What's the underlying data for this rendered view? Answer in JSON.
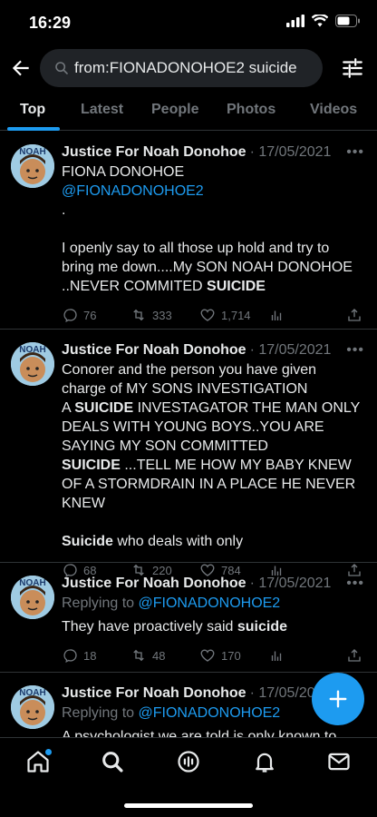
{
  "status": {
    "time": "16:29"
  },
  "search": {
    "query": "from:FIONADONOHOE2 suicide"
  },
  "tabs": [
    {
      "label": "Top"
    },
    {
      "label": "Latest"
    },
    {
      "label": "People"
    },
    {
      "label": "Photos"
    },
    {
      "label": "Videos"
    }
  ],
  "tweets": [
    {
      "author": "Justice For Noah Donohoe",
      "meta": "· 17/05/2021",
      "line1": "FIONA DONOHOE",
      "mention": "@FIONADONOHOE2",
      "dot": ".",
      "para1": "I openly say to all those up hold and try to bring me down....My SON NOAH DONOHOE ..NEVER COMMITED ",
      "para1_bold": "SUICIDE",
      "replies": "76",
      "retweets": "333",
      "likes": "1,714"
    },
    {
      "author": "Justice For Noah Donohoe",
      "meta": "· 17/05/2021",
      "line1": "Conorer and the person  you have given charge of MY SONS INVESTIGATION",
      "line2_pre": "A ",
      "line2_bold": "SUICIDE",
      "line2_post": " INVESTAGATOR THE MAN ONLY DEALS WITH YOUNG BOYS..YOU ARE SAYING MY SON COMMITTED",
      "line3_bold": "SUICIDE",
      "line3_post": " ...TELL ME HOW MY BABY KNEW OF A STORMDRAIN IN A PLACE HE NEVER KNEW",
      "line4_bold": "Suicide",
      "line4_post": " who deals with only",
      "replies": "68",
      "retweets": "220",
      "likes": "784"
    },
    {
      "author": "Justice For Noah Donohoe",
      "meta": "· 17/05/2021",
      "reply_label": "Replying to ",
      "reply_mention": "@FIONADONOHOE2",
      "text_pre": "They have proactively said ",
      "text_bold": "suicide",
      "replies": "18",
      "retweets": "48",
      "likes": "170"
    },
    {
      "author": "Justice For Noah Donohoe",
      "meta": "· 17/05/2021",
      "reply_label": "Replying to ",
      "reply_mention": "@FIONADONOHOE2",
      "text_pre": "A psychologist  we are told is only known to"
    }
  ],
  "avatar_text": "NOAH",
  "colors": {
    "accent": "#1d9bf0",
    "background": "#000000",
    "muted": "#71767b"
  }
}
